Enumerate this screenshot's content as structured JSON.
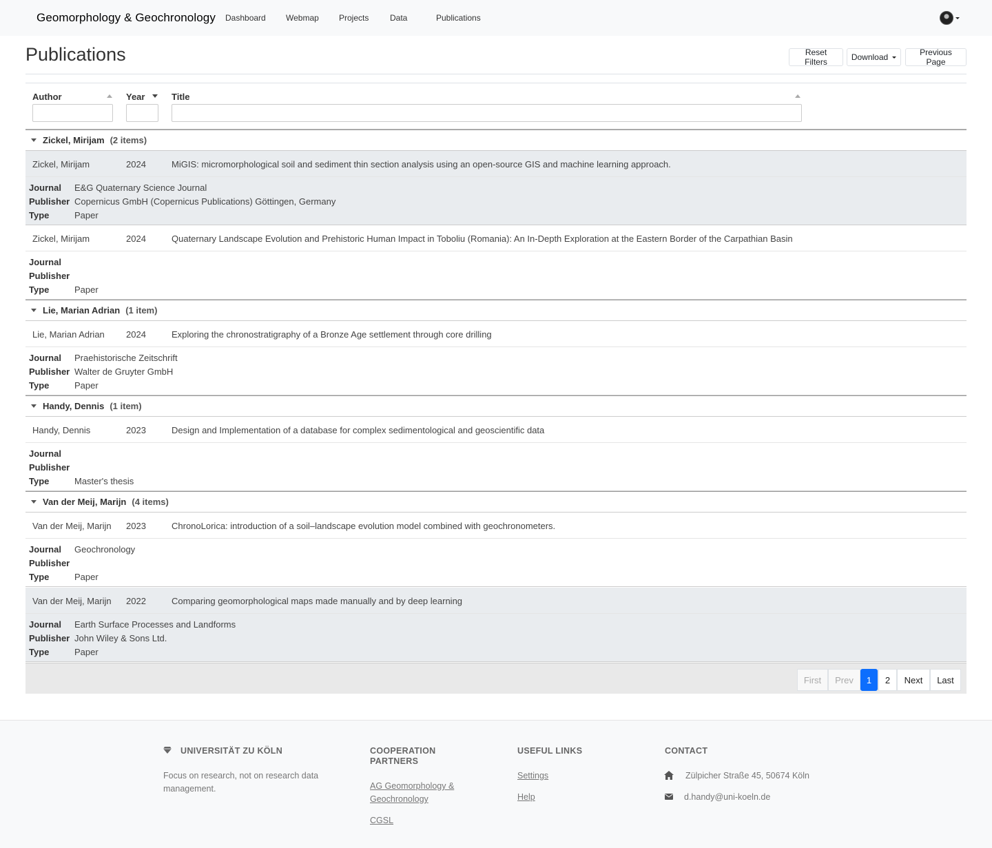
{
  "navbar": {
    "brand": "Geomorphology & Geochronology",
    "links": [
      "Dashboard",
      "Webmap",
      "Projects",
      "Data",
      "Publications"
    ]
  },
  "header": {
    "title": "Publications",
    "reset_label": "Reset Filters",
    "download_label": "Download",
    "previous_label": "Previous Page"
  },
  "columns": {
    "author": "Author",
    "year": "Year",
    "title": "Title"
  },
  "detail_labels": {
    "journal": "Journal",
    "publisher": "Publisher",
    "type": "Type"
  },
  "groups": [
    {
      "name": "Zickel, Mirijam",
      "count": "(2 items)",
      "items": [
        {
          "author": "Zickel, Mirijam",
          "year": "2024",
          "title": "MiGIS: micromorphological soil and sediment thin section analysis using an open-source GIS and machine learning approach.",
          "journal": "E&G Quaternary Science Journal",
          "publisher": "Copernicus GmbH (Copernicus Publications) Göttingen, Germany",
          "type": "Paper"
        },
        {
          "author": "Zickel, Mirijam",
          "year": "2024",
          "title": "Quaternary Landscape Evolution and Prehistoric Human Impact in Toboliu (Romania): An In-Depth Exploration at the Eastern Border of the Carpathian Basin",
          "journal": "",
          "publisher": "",
          "type": "Paper"
        }
      ]
    },
    {
      "name": "Lie, Marian Adrian",
      "count": "(1 item)",
      "items": [
        {
          "author": "Lie, Marian Adrian",
          "year": "2024",
          "title": "Exploring the chronostratigraphy of a Bronze Age settlement through core drilling",
          "journal": "Praehistorische Zeitschrift",
          "publisher": "Walter de Gruyter GmbH",
          "type": "Paper"
        }
      ]
    },
    {
      "name": "Handy, Dennis",
      "count": "(1 item)",
      "items": [
        {
          "author": "Handy, Dennis",
          "year": "2023",
          "title": "Design and Implementation of a database for complex sedimentological and geoscientific data",
          "journal": "",
          "publisher": "",
          "type": "Master's thesis"
        }
      ]
    },
    {
      "name": "Van der Meij, Marijn",
      "count": "(4 items)",
      "items": [
        {
          "author": "Van der Meij, Marijn",
          "year": "2023",
          "title": "ChronoLorica: introduction of a soil–landscape evolution model combined with geochronometers.",
          "journal": "Geochronology",
          "publisher": "",
          "type": "Paper"
        },
        {
          "author": "Van der Meij, Marijn",
          "year": "2022",
          "title": "Comparing geomorphological maps made manually and by deep learning",
          "journal": "Earth Surface Processes and Landforms",
          "publisher": "John Wiley & Sons Ltd.",
          "type": "Paper"
        }
      ]
    }
  ],
  "pagination": {
    "first": "First",
    "prev": "Prev",
    "pages": [
      "1",
      "2"
    ],
    "current": "1",
    "next": "Next",
    "last": "Last"
  },
  "footer": {
    "university": "UNIVERSITÄT ZU KÖLN",
    "tagline": "Focus on research, not on research data management.",
    "cooperation_heading": "COOPERATION PARTNERS",
    "partners": [
      "AG Geomorphology & Geochronology",
      "CGSL"
    ],
    "useful_heading": "USEFUL LINKS",
    "useful_links": [
      "Settings",
      "Help"
    ],
    "contact_heading": "CONTACT",
    "address": "Zülpicher Straße 45, 50674 Köln",
    "email": "d.handy@uni-koeln.de"
  }
}
